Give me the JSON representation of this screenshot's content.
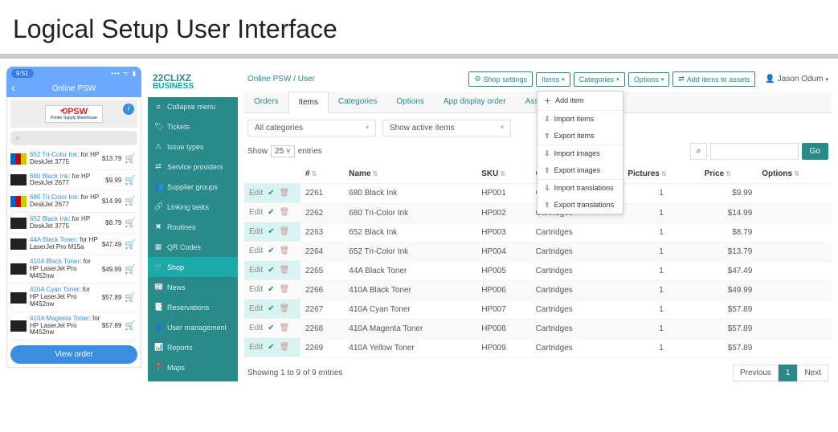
{
  "slide": {
    "title": "Logical Setup User Interface"
  },
  "phone": {
    "time": "9:51",
    "header": "Online PSW",
    "brand": "PSW",
    "brand_sub": "Printer Supply Warehouse",
    "search_placeholder": "",
    "items": [
      {
        "name": "652 Tri-Color Ink",
        "sub": ": for HP DeskJet 3775",
        "price": "$13.79",
        "tri": true
      },
      {
        "name": "680 Black Ink",
        "sub": ": for HP DeskJet 2677",
        "price": "$9.99",
        "tri": false
      },
      {
        "name": "680 Tri-Color Ink",
        "sub": ": for HP DeskJet 2677",
        "price": "$14.99",
        "tri": true
      },
      {
        "name": "652 Black Ink",
        "sub": ": for HP DeskJet 3775",
        "price": "$8.79",
        "tri": false
      },
      {
        "name": "44A Black Toner",
        "sub": ": for HP LaserJet Pro M15a",
        "price": "$47.49",
        "tri": false
      },
      {
        "name": "410A Black Toner",
        "sub": ": for HP LaserJet Pro M452nw",
        "price": "$49.99",
        "tri": false
      },
      {
        "name": "410A Cyan Toner",
        "sub": ": for HP LaserJet Pro M452nw",
        "price": "$57.89",
        "tri": false
      },
      {
        "name": "410A Magenta Toner",
        "sub": ": for HP LaserJet Pro M452nw",
        "price": "$57.89",
        "tri": false
      }
    ],
    "view_order": "View order"
  },
  "sidebar": {
    "logo1": "2CLIXZ",
    "logo2": "BUSINESS",
    "items": [
      "Collapse menu",
      "Tickets",
      "Issue types",
      "Service providers",
      "Supplier groups",
      "Linking tasks",
      "Routines",
      "QR Codes",
      "Shop",
      "News",
      "Reservations",
      "User management",
      "Reports",
      "Maps"
    ],
    "active_index": 8
  },
  "topbar": {
    "crumb": "Online PSW / User",
    "buttons": {
      "shop_settings": "Shop settings",
      "items": "Items",
      "categories": "Categories",
      "options": "Options",
      "add_assets": "Add items to assets"
    },
    "user": "Jason Odum",
    "dropdown": [
      "Add item",
      "Import items",
      "Export items",
      "Import images",
      "Export images",
      "Import translations",
      "Export translations"
    ]
  },
  "tabs": {
    "items": [
      "Orders",
      "Items",
      "Categories",
      "Options",
      "App display order",
      "Asset items"
    ],
    "active_index": 1
  },
  "filters": {
    "category": "All categories",
    "status": "Show active items"
  },
  "table": {
    "show_prefix": "Show",
    "show_value": "25",
    "show_suffix": "entries",
    "go": "Go",
    "columns": [
      "",
      "#",
      "Name",
      "SKU",
      "Categories",
      "Pictures",
      "Price",
      "Options"
    ],
    "edit_label": "Edit",
    "rows": [
      {
        "num": "2261",
        "name": "680 Black Ink",
        "sku": "HP001",
        "cat": "Cartridges",
        "pic": "1",
        "price": "$9.99"
      },
      {
        "num": "2262",
        "name": "680 Tri-Color Ink",
        "sku": "HP002",
        "cat": "Cartridges",
        "pic": "1",
        "price": "$14.99"
      },
      {
        "num": "2263",
        "name": "652 Black Ink",
        "sku": "HP003",
        "cat": "Cartridges",
        "pic": "1",
        "price": "$8.79"
      },
      {
        "num": "2264",
        "name": "652 Tri-Color Ink",
        "sku": "HP004",
        "cat": "Cartridges",
        "pic": "1",
        "price": "$13.79"
      },
      {
        "num": "2265",
        "name": "44A Black Toner",
        "sku": "HP005",
        "cat": "Cartridges",
        "pic": "1",
        "price": "$47.49"
      },
      {
        "num": "2266",
        "name": "410A Black Toner",
        "sku": "HP006",
        "cat": "Cartridges",
        "pic": "1",
        "price": "$49.99"
      },
      {
        "num": "2267",
        "name": "410A Cyan Toner",
        "sku": "HP007",
        "cat": "Cartridges",
        "pic": "1",
        "price": "$57.89"
      },
      {
        "num": "2268",
        "name": "410A Magenta Toner",
        "sku": "HP008",
        "cat": "Cartridges",
        "pic": "1",
        "price": "$57.89"
      },
      {
        "num": "2269",
        "name": "410A Yellow Toner",
        "sku": "HP009",
        "cat": "Cartridges",
        "pic": "1",
        "price": "$57.89"
      }
    ],
    "footer": "Showing 1 to 9 of 9 entries",
    "prev": "Previous",
    "page": "1",
    "next": "Next"
  }
}
